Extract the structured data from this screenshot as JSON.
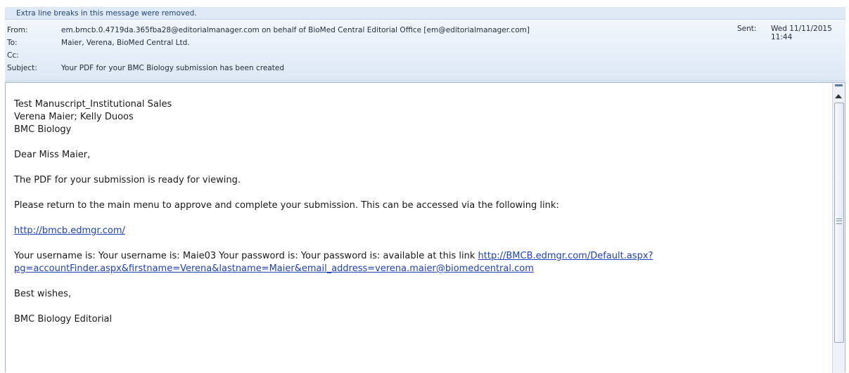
{
  "info_bar": "Extra line breaks in this message were removed.",
  "header": {
    "from_label": "From:",
    "from_value": "em.bmcb.0.4719da.365fba28@editorialmanager.com on behalf of BioMed Central Editorial Office [em@editorialmanager.com]",
    "to_label": "To:",
    "to_value": "Maier, Verena, BioMed Central Ltd.",
    "cc_label": "Cc:",
    "cc_value": "",
    "subject_label": "Subject:",
    "subject_value": "Your PDF for your BMC Biology submission has been created",
    "sent_label": "Sent:",
    "sent_value": "Wed 11/11/2015 11:44"
  },
  "body": {
    "line1": "Test Manuscript_Institutional Sales",
    "line2": "Verena Maier; Kelly Duoos",
    "line3": "BMC Biology",
    "greeting": "Dear Miss Maier,",
    "para1": "The PDF for your submission is ready for viewing.",
    "para2": "Please return to the main menu to approve and complete your submission. This can be accessed via the following link:",
    "link1": "http://bmcb.edmgr.com/",
    "para3_text": "Your username is: Your username is: Maie03 Your password is: Your password is: available at this link ",
    "link2_part1": "http://BMCB.edmgr.com/Default.aspx?",
    "link2_part2": "pg=accountFinder.aspx&firstname=Verena&lastname=Maier&email_address=verena.maier@biomedcentral.com",
    "closing": "Best wishes,",
    "signature": "BMC Biology Editorial"
  }
}
